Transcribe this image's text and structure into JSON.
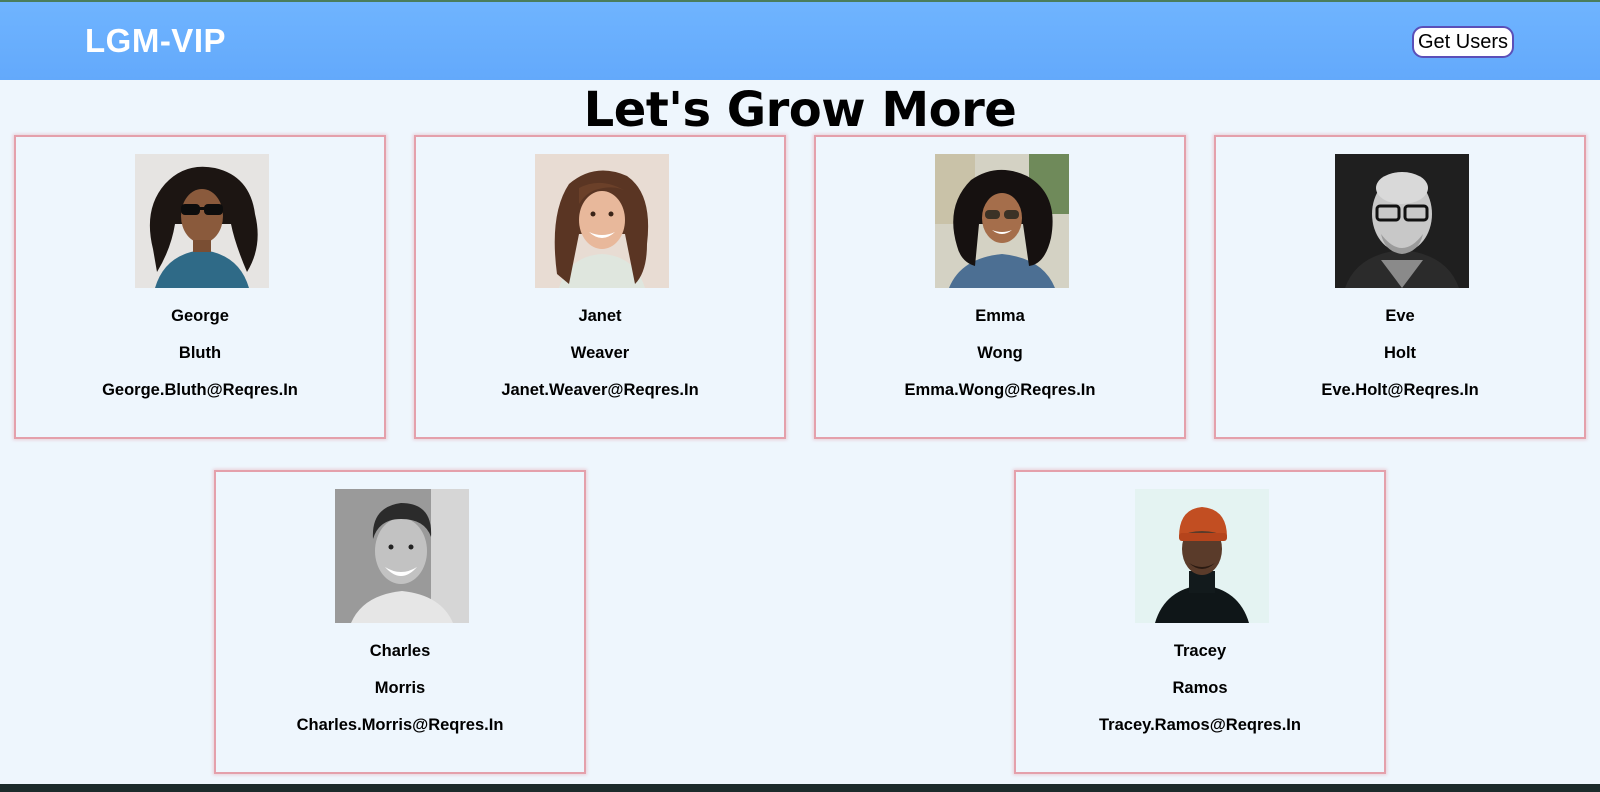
{
  "app": {
    "brand": "LGM-VIP",
    "get_users_label": "Get Users",
    "page_title": "Let's Grow More"
  },
  "users": [
    {
      "first_name": "George",
      "last_name": "Bluth",
      "email": "George.Bluth@Reqres.In",
      "avatar": "portrait-man-sunglasses-curly-hair"
    },
    {
      "first_name": "Janet",
      "last_name": "Weaver",
      "email": "Janet.Weaver@Reqres.In",
      "avatar": "portrait-woman-smiling-curly-hair"
    },
    {
      "first_name": "Emma",
      "last_name": "Wong",
      "email": "Emma.Wong@Reqres.In",
      "avatar": "portrait-woman-sunglasses-afro"
    },
    {
      "first_name": "Eve",
      "last_name": "Holt",
      "email": "Eve.Holt@Reqres.In",
      "avatar": "portrait-bald-man-glasses-bw"
    },
    {
      "first_name": "Charles",
      "last_name": "Morris",
      "email": "Charles.Morris@Reqres.In",
      "avatar": "portrait-man-smiling-bw"
    },
    {
      "first_name": "Tracey",
      "last_name": "Ramos",
      "email": "Tracey.Ramos@Reqres.In",
      "avatar": "portrait-man-orange-beanie"
    }
  ],
  "colors": {
    "navbar": "#6fb4ff",
    "page_background": "#eef6fd",
    "card_border": "#e4a0ab",
    "button_border": "#5b4fb8"
  }
}
